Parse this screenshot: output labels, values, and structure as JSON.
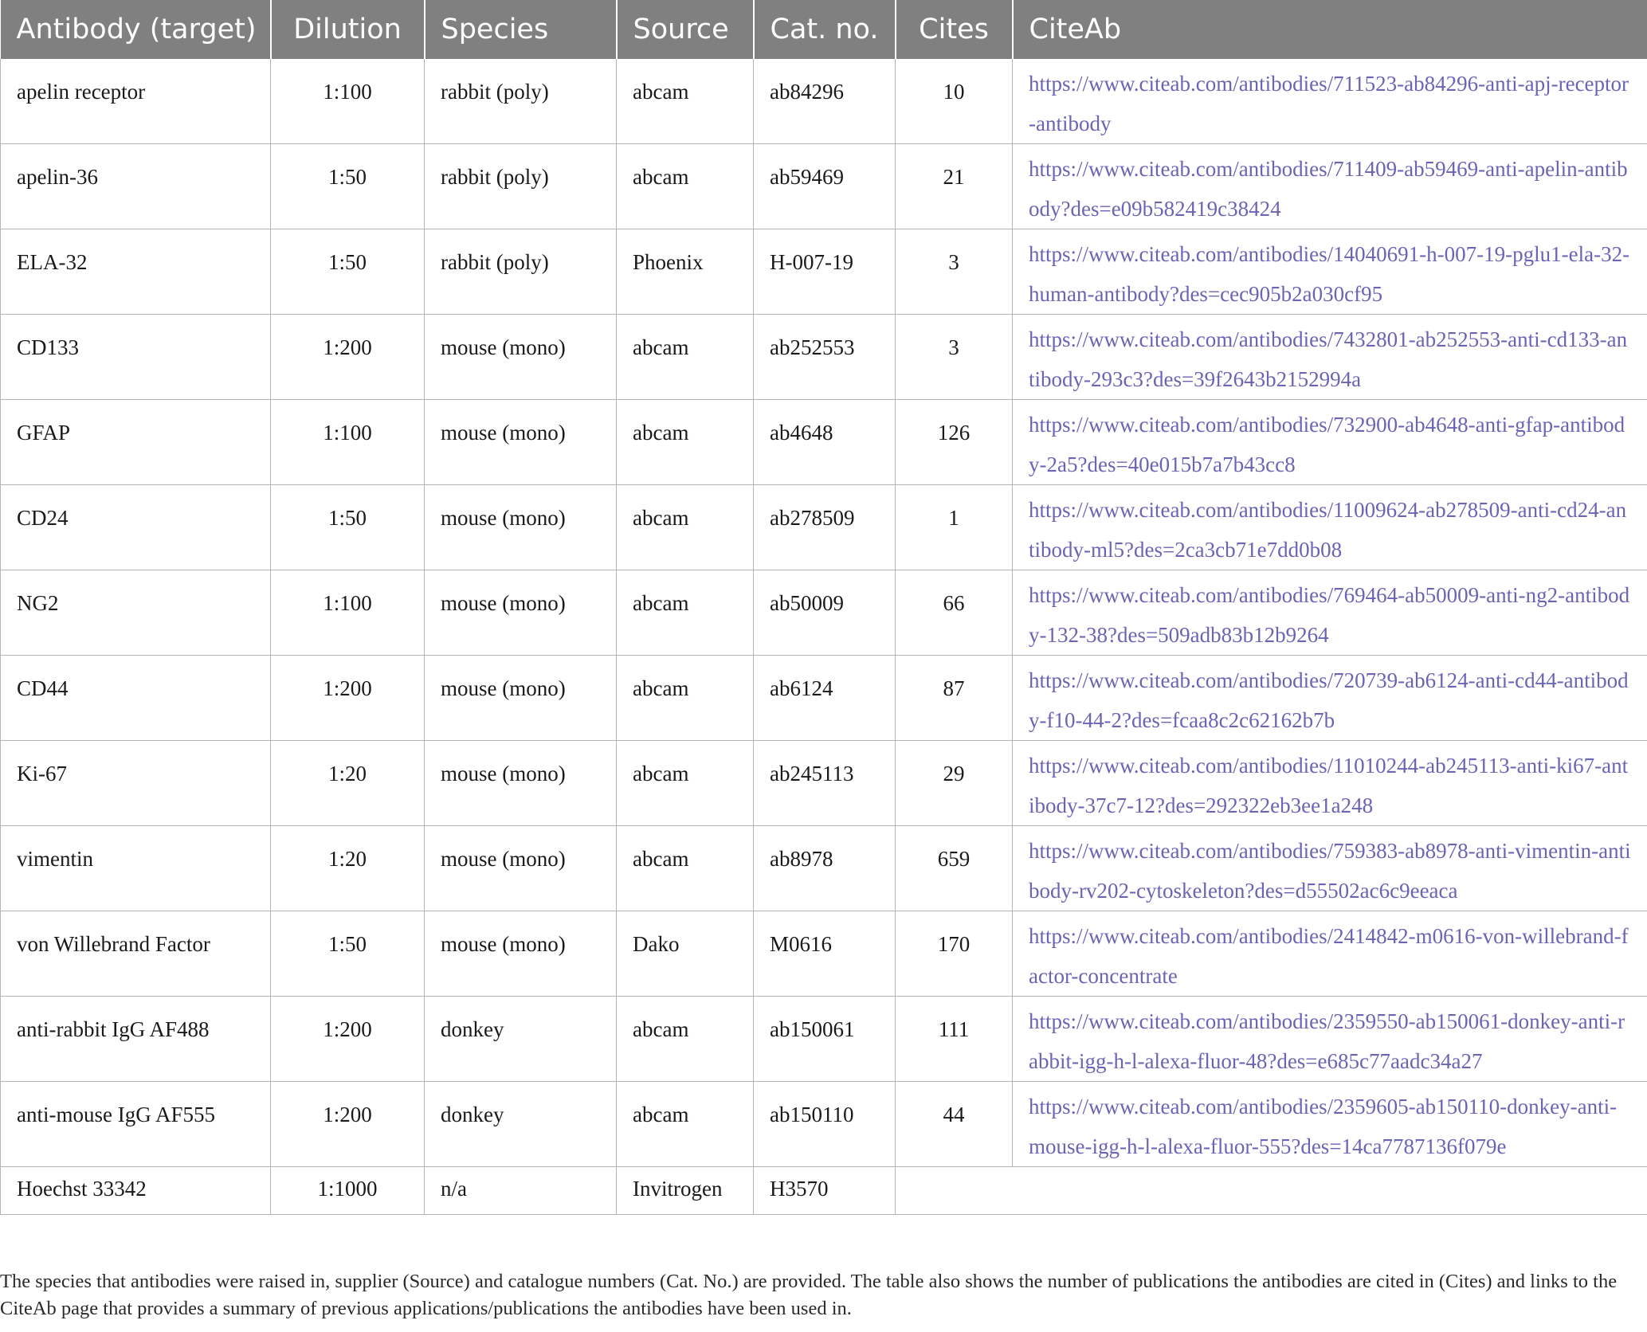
{
  "table": {
    "headers": [
      "Antibody (target)",
      "Dilution",
      "Species",
      "Source",
      "Cat. no.",
      "Cites",
      "CiteAb"
    ],
    "rows": [
      {
        "target": "apelin receptor",
        "dilution": "1:100",
        "species": "rabbit (poly)",
        "source": "abcam",
        "cat": "ab84296",
        "cites": "10",
        "link": "https://www.citeab.com/antibodies/711523-ab84296-anti-apj-receptor-antibody"
      },
      {
        "target": "apelin-36",
        "dilution": "1:50",
        "species": "rabbit (poly)",
        "source": "abcam",
        "cat": "ab59469",
        "cites": "21",
        "link": "https://www.citeab.com/antibodies/711409-ab59469-anti-apelin-antibody?des=e09b582419c38424"
      },
      {
        "target": "ELA-32",
        "dilution": "1:50",
        "species": "rabbit (poly)",
        "source": "Phoenix",
        "cat": "H-007-19",
        "cites": "3",
        "link": "https://www.citeab.com/antibodies/14040691-h-007-19-pglu1-ela-32-human-antibody?des=cec905b2a030cf95"
      },
      {
        "target": "CD133",
        "dilution": "1:200",
        "species": "mouse (mono)",
        "source": "abcam",
        "cat": "ab252553",
        "cites": "3",
        "link": "https://www.citeab.com/antibodies/7432801-ab252553-anti-cd133-antibody-293c3?des=39f2643b2152994a"
      },
      {
        "target": "GFAP",
        "dilution": "1:100",
        "species": "mouse (mono)",
        "source": "abcam",
        "cat": "ab4648",
        "cites": "126",
        "link": "https://www.citeab.com/antibodies/732900-ab4648-anti-gfap-antibody-2a5?des=40e015b7a7b43cc8"
      },
      {
        "target": "CD24",
        "dilution": "1:50",
        "species": "mouse (mono)",
        "source": "abcam",
        "cat": "ab278509",
        "cites": "1",
        "link": "https://www.citeab.com/antibodies/11009624-ab278509-anti-cd24-antibody-ml5?des=2ca3cb71e7dd0b08"
      },
      {
        "target": "NG2",
        "dilution": "1:100",
        "species": "mouse (mono)",
        "source": "abcam",
        "cat": "ab50009",
        "cites": "66",
        "link": "https://www.citeab.com/antibodies/769464-ab50009-anti-ng2-antibody-132-38?des=509adb83b12b9264"
      },
      {
        "target": "CD44",
        "dilution": "1:200",
        "species": "mouse (mono)",
        "source": "abcam",
        "cat": "ab6124",
        "cites": "87",
        "link": "https://www.citeab.com/antibodies/720739-ab6124-anti-cd44-antibody-f10-44-2?des=fcaa8c2c62162b7b"
      },
      {
        "target": "Ki-67",
        "dilution": "1:20",
        "species": "mouse (mono)",
        "source": "abcam",
        "cat": "ab245113",
        "cites": "29",
        "link": "https://www.citeab.com/antibodies/11010244-ab245113-anti-ki67-antibody-37c7-12?des=292322eb3ee1a248"
      },
      {
        "target": "vimentin",
        "dilution": "1:20",
        "species": "mouse (mono)",
        "source": "abcam",
        "cat": "ab8978",
        "cites": "659",
        "link": "https://www.citeab.com/antibodies/759383-ab8978-anti-vimentin-antibody-rv202-cytoskeleton?des=d55502ac6c9eeaca"
      },
      {
        "target": "von Willebrand Factor",
        "dilution": "1:50",
        "species": "mouse (mono)",
        "source": "Dako",
        "cat": "M0616",
        "cites": "170",
        "link": "https://www.citeab.com/antibodies/2414842-m0616-von-willebrand-factor-concentrate"
      },
      {
        "target": "anti-rabbit IgG AF488",
        "dilution": "1:200",
        "species": "donkey",
        "source": "abcam",
        "cat": "ab150061",
        "cites": "111",
        "link": "https://www.citeab.com/antibodies/2359550-ab150061-donkey-anti-rabbit-igg-h-l-alexa-fluor-48?des=e685c77aadc34a27"
      },
      {
        "target": "anti-mouse IgG AF555",
        "dilution": "1:200",
        "species": "donkey",
        "source": "abcam",
        "cat": "ab150110",
        "cites": "44",
        "link": "https://www.citeab.com/antibodies/2359605-ab150110-donkey-anti-mouse-igg-h-l-alexa-fluor-555?des=14ca7787136f079e"
      },
      {
        "target": "Hoechst 33342",
        "dilution": "1:1000",
        "species": "n/a",
        "source": "Invitrogen",
        "cat": "H3570",
        "cites": "",
        "link": ""
      }
    ]
  },
  "caption": "The species that antibodies were raised in, supplier (Source) and catalogue numbers (Cat. No.) are provided. The table also shows the number of publications the antibodies are cited in (Cites) and links to the CiteAb page that provides a summary of previous applications/publications the antibodies have been used in.",
  "colors": {
    "header_bg": "#808080",
    "header_text": "#ffffff",
    "link": "#6a64b5",
    "grid": "#b4b4b4"
  }
}
